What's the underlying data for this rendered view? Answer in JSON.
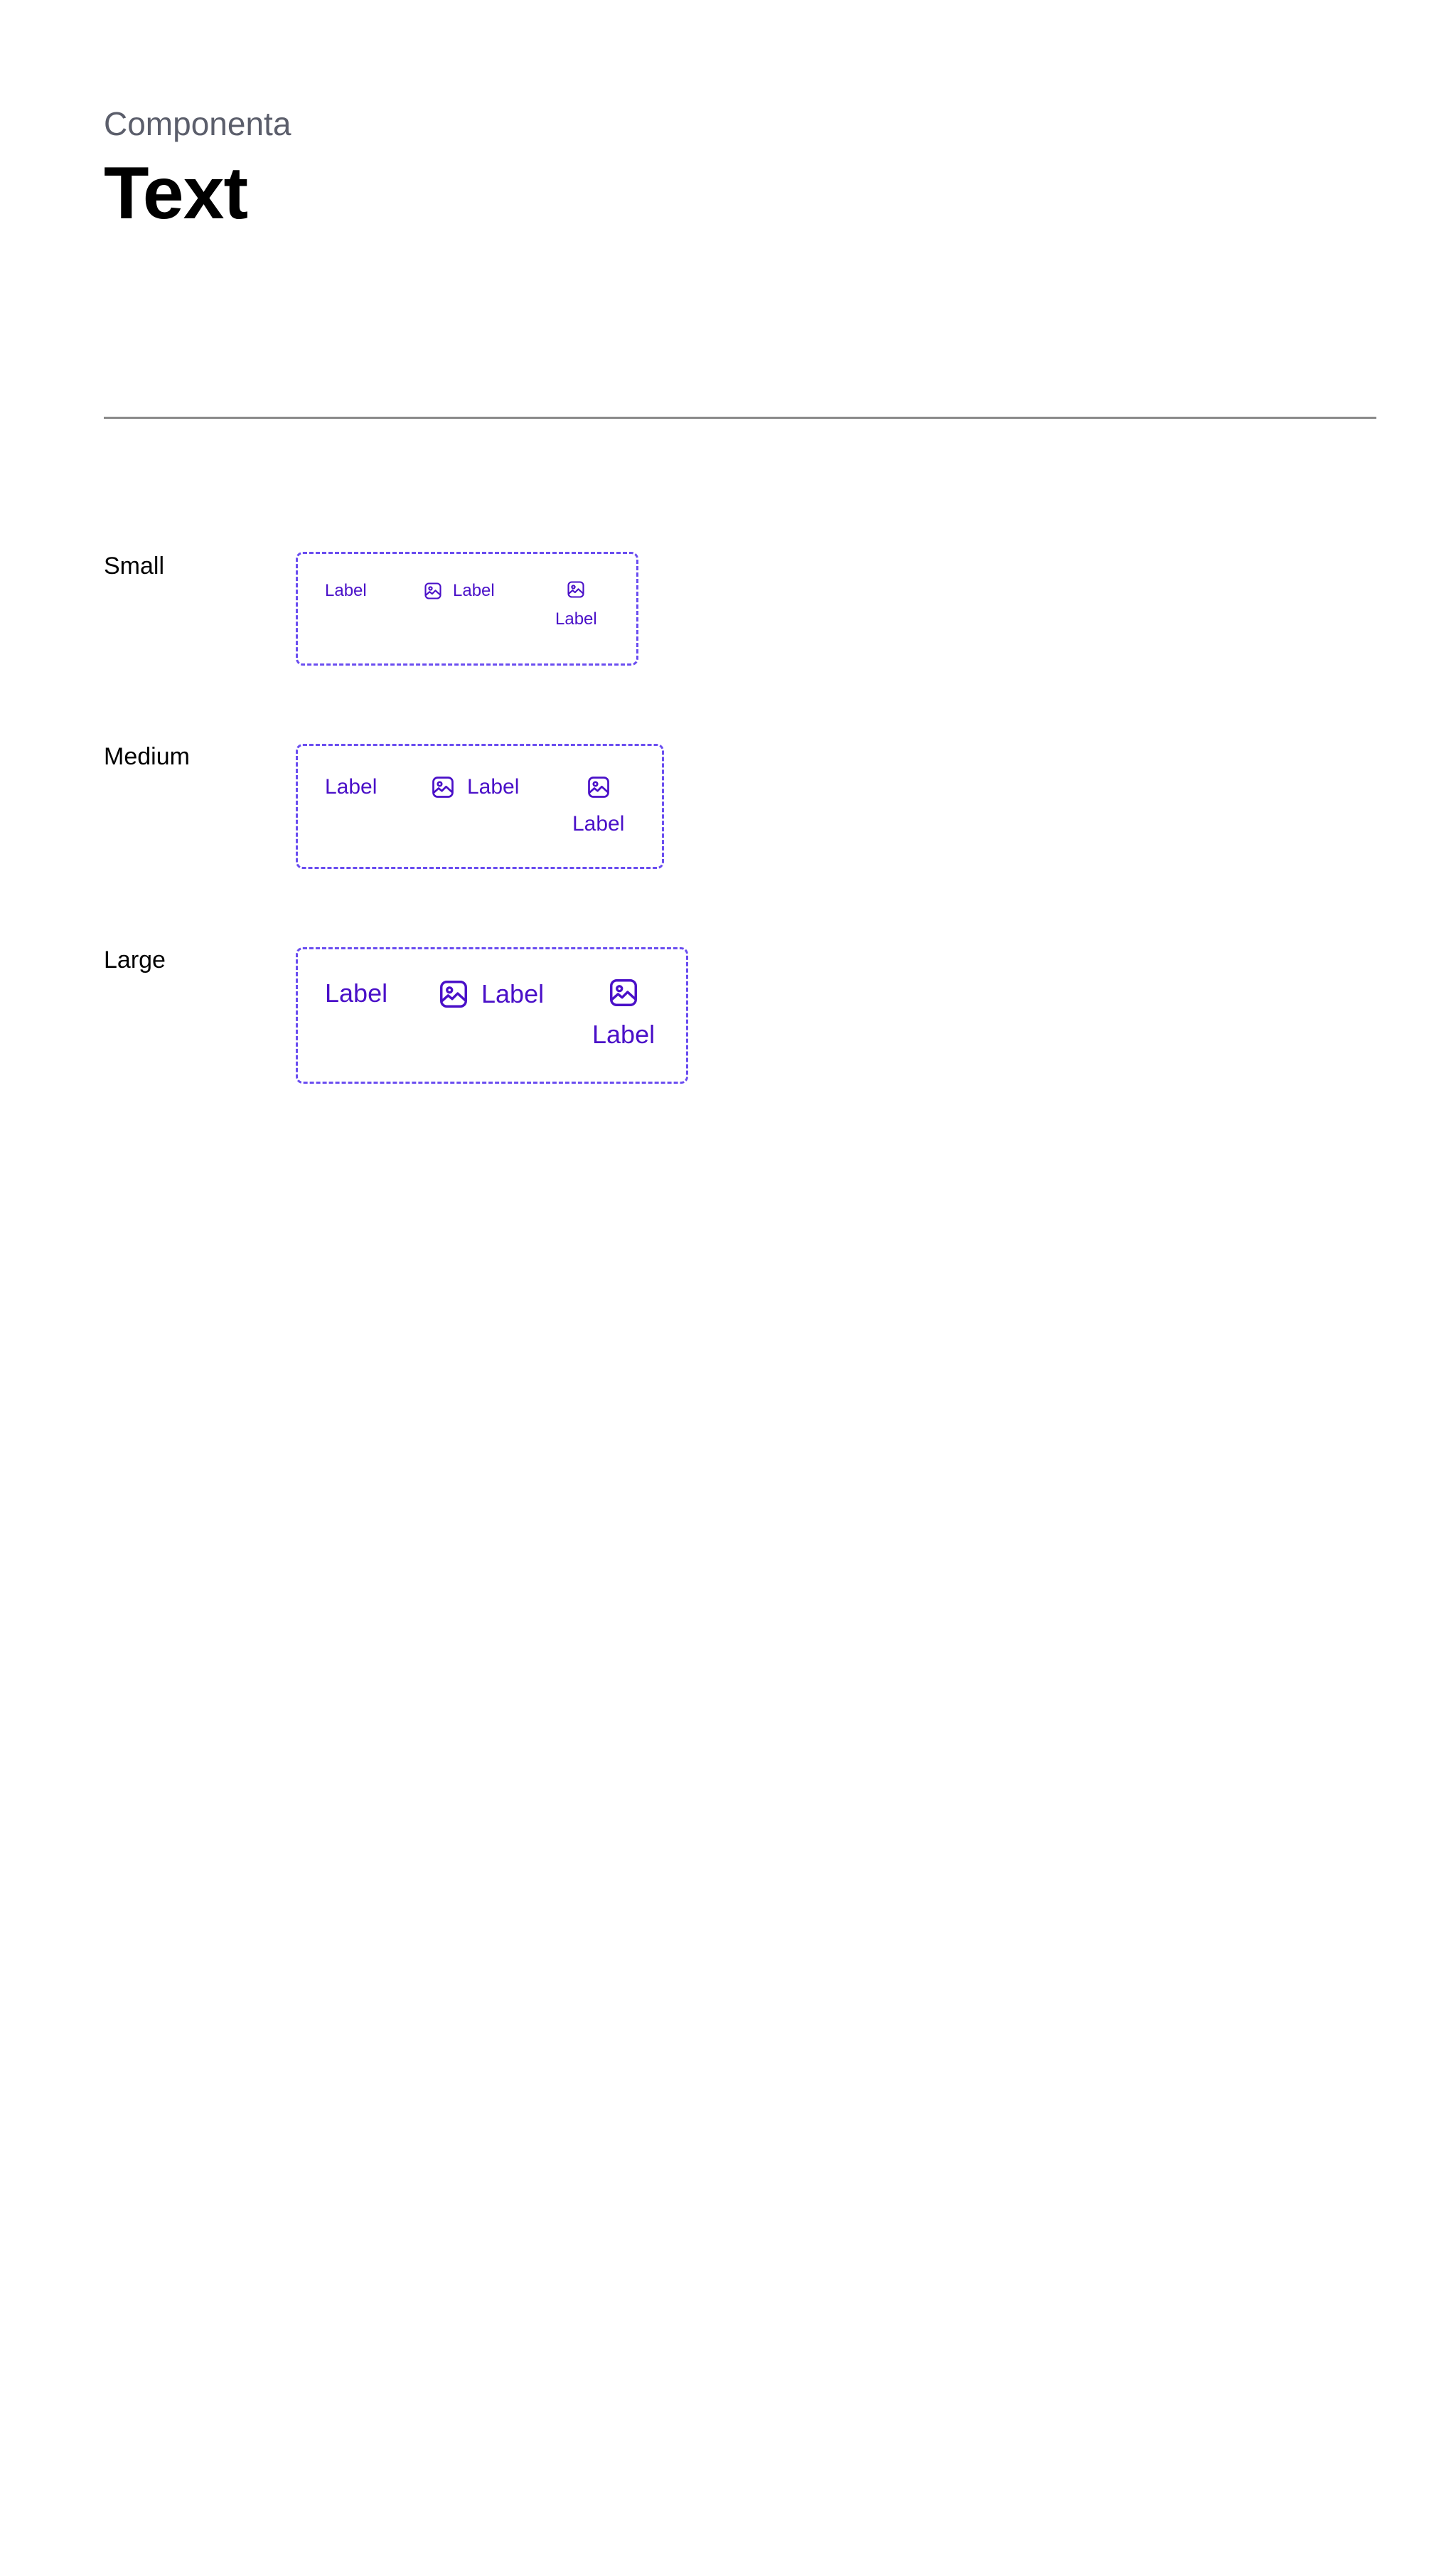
{
  "header": {
    "eyebrow": "Componenta",
    "title": "Text"
  },
  "colors": {
    "accent": "#4a10c8",
    "frame_border": "#6a4df0",
    "eyebrow": "#5b5e6b",
    "divider": "#8a8a8a"
  },
  "rows": [
    {
      "label": "Small",
      "items": [
        {
          "text": "Label",
          "icon": null
        },
        {
          "text": "Label",
          "icon": "image-icon",
          "layout": "inline"
        },
        {
          "text": "Label",
          "icon": "image-icon",
          "layout": "stacked"
        }
      ]
    },
    {
      "label": "Medium",
      "items": [
        {
          "text": "Label",
          "icon": null
        },
        {
          "text": "Label",
          "icon": "image-icon",
          "layout": "inline"
        },
        {
          "text": "Label",
          "icon": "image-icon",
          "layout": "stacked"
        }
      ]
    },
    {
      "label": "Large",
      "items": [
        {
          "text": "Label",
          "icon": null
        },
        {
          "text": "Label",
          "icon": "image-icon",
          "layout": "inline"
        },
        {
          "text": "Label",
          "icon": "image-icon",
          "layout": "stacked"
        }
      ]
    }
  ]
}
